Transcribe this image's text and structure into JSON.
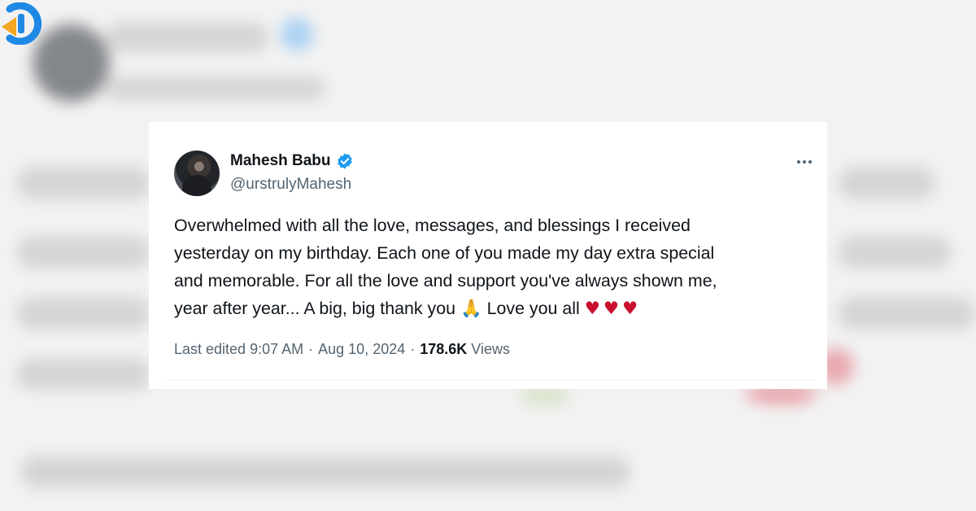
{
  "tweet": {
    "author_name": "Mahesh Babu",
    "handle": "@urstrulyMahesh",
    "verified": true,
    "text_lines": [
      "Overwhelmed with all the love, messages, and blessings I received",
      "yesterday on my birthday. Each one of you made my day extra special",
      "and memorable. For all the love and support you've always shown me,",
      "year after year... A big, big thank you"
    ],
    "text_tail": "Love you all",
    "emoji_pray": "🙏",
    "emoji_hearts": "♥♥♥",
    "edited_label": "Last edited",
    "time": "9:07 AM",
    "date": "Aug 10, 2024",
    "separator": "·",
    "views_count": "178.6K",
    "views_label": "Views"
  },
  "colors": {
    "text": "#0f1419",
    "muted": "#536471",
    "verified": "#1d9bf0",
    "heart": "#c8102e",
    "logo_blue": "#1e88e5",
    "logo_orange": "#f5a623"
  },
  "icons": {
    "verified": "verified-badge-icon",
    "more": "more-options-icon",
    "logo": "site-logo"
  }
}
